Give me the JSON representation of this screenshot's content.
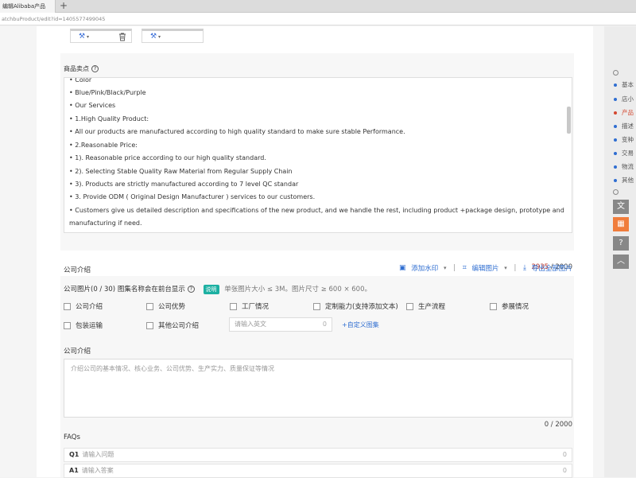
{
  "browser": {
    "tab_title": "编辑Alibaba产品",
    "new_tab": "+",
    "url": "atchbuProduct/edit?id=1405577499045"
  },
  "selling_points": {
    "label": "商品卖点",
    "lines": [
      "• Color",
      "• Blue/Pink/Black/Purple",
      "• Our Services",
      "• 1.High Quality Product:",
      "• All our products are manufactured according to high quality standard to make sure stable Performance.",
      "• 2.Reasonable Price:",
      "• 1). Reasonable price according to our high quality standard.",
      "• 2). Selecting Stable Quality Raw Material from Regular Supply Chain",
      "• 3). Products are strictly manufactured according to 7 level QC standar",
      "• 3. Provide ODM ( Original Design Manufacturer ) services to our customers.",
      "• Customers give us detailed description and specifications of the new product, and we handle the rest, including product +package design, prototype and",
      "manufacturing if need."
    ],
    "count_current": "2935",
    "count_max": "/ 2000"
  },
  "company_intro": {
    "title": "公司介绍",
    "toolbar": {
      "watermark": "添加水印",
      "edit_images": "编辑图片",
      "export_all": "导出全部图片"
    },
    "images_label": "公司图片(0 / 30) 图集名称会在前台显示",
    "badge": "说明",
    "note": "单张图片大小 ≤ 3M。图片尺寸 ≥ 600 × 600。",
    "checkboxes": [
      "公司介绍",
      "公司优势",
      "工厂情况",
      "定制能力(支持添加文本)",
      "生产流程",
      "参展情况",
      "包装运输",
      "其他公司介绍"
    ],
    "english_placeholder": "请输入英文",
    "english_count": "0",
    "custom_link": "+自定义图集",
    "intro_label": "公司介绍",
    "intro_placeholder": "介绍公司的基本情况、核心业务、公司优势、生产实力、质量保证等情况",
    "intro_count": "0 / 2000"
  },
  "faqs": {
    "title": "FAQs",
    "rows": [
      {
        "tag": "Q1",
        "placeholder": "请输入问题",
        "count": "0"
      },
      {
        "tag": "A1",
        "placeholder": "请输入答案",
        "count": "0"
      }
    ]
  },
  "right_nav": {
    "items": [
      "基本",
      "店小",
      "产品",
      "描述",
      "变种",
      "交易",
      "物流",
      "其他"
    ],
    "active_index": 2,
    "translate_icon": "translate-icon",
    "help_icon": "help-icon",
    "top_icon": "back-to-top-icon"
  }
}
